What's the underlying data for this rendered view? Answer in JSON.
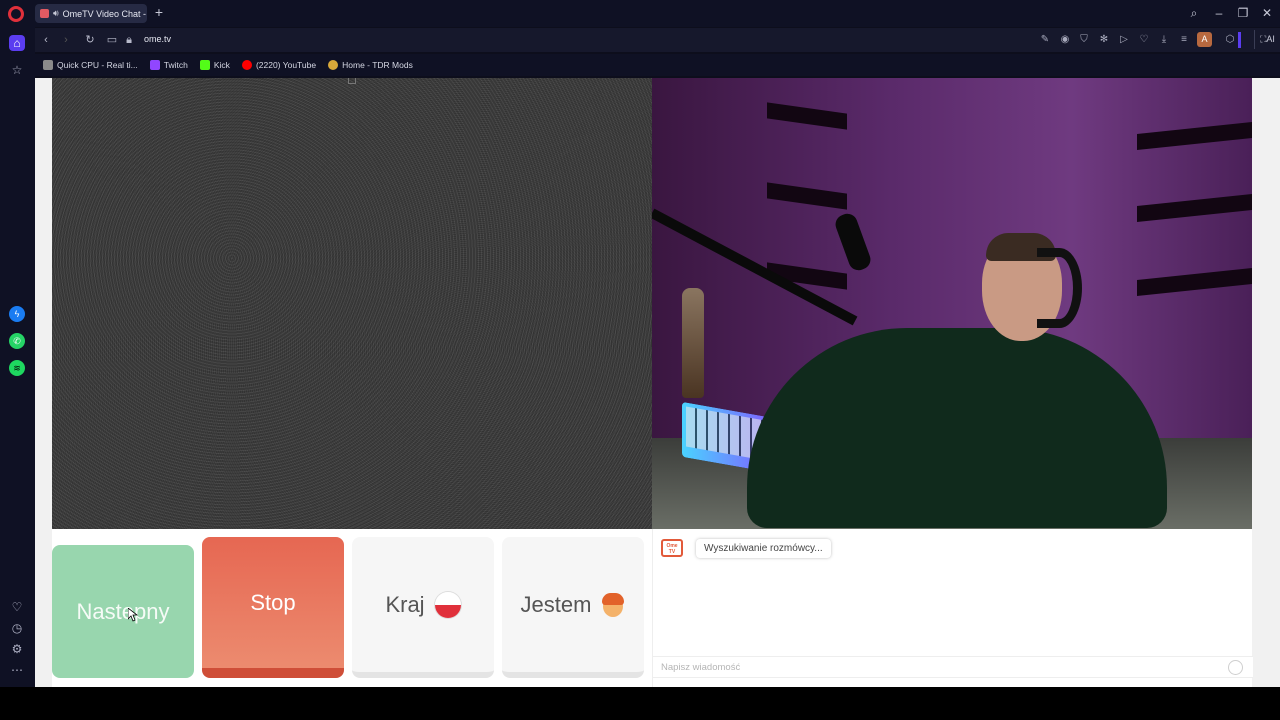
{
  "browser": {
    "tab_title": "OmeTV Video Chat -",
    "new_tab": "+",
    "url": "ome.tv",
    "window_buttons": {
      "search": "⌕",
      "minimize": "–",
      "restore": "❐",
      "close": "✕"
    },
    "ai_label": "⛶AI",
    "profile_initial": "A"
  },
  "bookmarks": [
    {
      "label": "Quick CPU - Real ti...",
      "color": "#8a8a8a"
    },
    {
      "label": "Twitch",
      "color": "#9146ff"
    },
    {
      "label": "Kick",
      "color": "#53fc18"
    },
    {
      "label": "(2220) YouTube",
      "color": "#ff0000"
    },
    {
      "label": "Home - TDR Mods",
      "color": "#d9a93a"
    }
  ],
  "controls": {
    "next_label": "Nastepny",
    "stop_label": "Stop",
    "country_label": "Kraj",
    "gender_label": "Jestem"
  },
  "chat": {
    "logo_text": "Ome TV",
    "status_message": "Wyszukiwanie rozmówcy...",
    "input_placeholder": "Napisz wiadomość"
  },
  "colors": {
    "next": "#98d6ae",
    "stop": "#e66752",
    "accent_red": "#e0303b"
  }
}
